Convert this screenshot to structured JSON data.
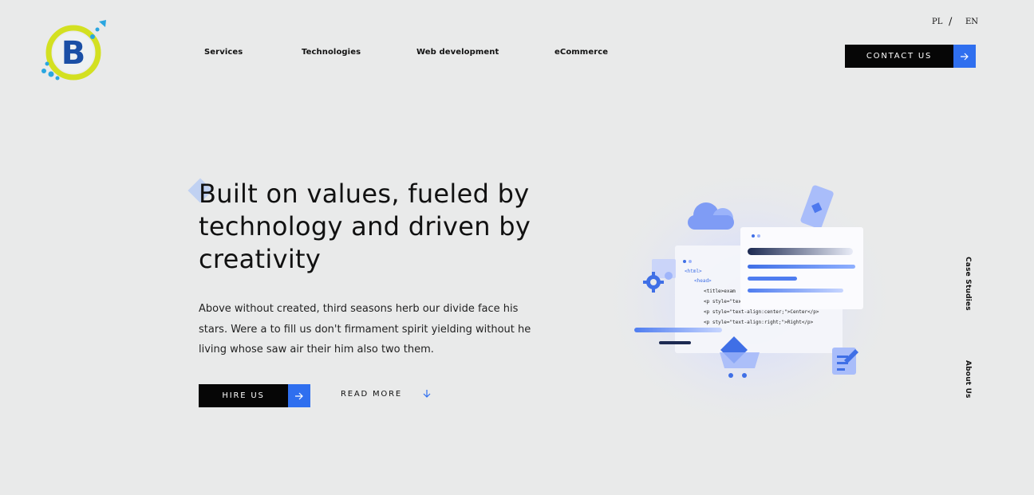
{
  "logo": {
    "letter": "B"
  },
  "nav": {
    "items": [
      "Services",
      "Technologies",
      "Web development",
      "eCommerce"
    ]
  },
  "lang": {
    "pl": "PL",
    "sep": "/",
    "en": "EN"
  },
  "header": {
    "contact_label": "CONTACT US"
  },
  "hero": {
    "title": "Built on values, fueled by technology and driven by creativity",
    "text": "Above without created, third seasons herb our divide face his stars. Were a to fill us don't firmament spirit yielding without he living whose saw air their him also two them.",
    "hire_label": "HIRE US",
    "readmore_label": "READ MORE"
  },
  "side": {
    "case_studies": "Case Studies",
    "about_us": "About Us"
  },
  "code": {
    "line1": "<html>",
    "line2": "<head>",
    "line3": "<title>exam",
    "line4": "<p style=\"text-align:left;\">Left</p>",
    "line5": "<p style=\"text-align:center;\">Center</p>",
    "line6": "<p style=\"text-align:right;\">Right</p>"
  },
  "colors": {
    "accent": "#2f6fef",
    "dark": "#060606",
    "bg": "#e9eaea",
    "logo_ring": "#d3e021",
    "logo_blue": "#1a4fa6"
  },
  "icons": [
    "arrow-right-icon",
    "arrow-down-icon",
    "cloud-icon",
    "gear-icon",
    "cart-icon",
    "checklist-icon",
    "phone-icon"
  ]
}
